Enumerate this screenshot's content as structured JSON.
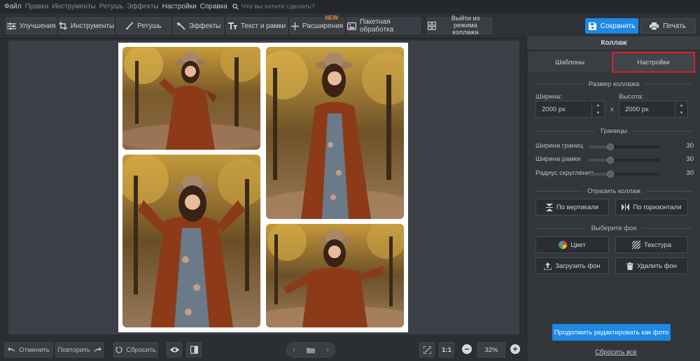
{
  "menu": {
    "items": [
      "Файл",
      "Правка",
      "Инструменты",
      "Ретушь",
      "Эффекты",
      "Настройки",
      "Справка"
    ],
    "search_placeholder": "Что вы хотите сделать?"
  },
  "toolbar": {
    "enhance": "Улучшения",
    "tools": "Инструменты",
    "retouch": "Ретушь",
    "effects": "Эффекты",
    "text_frames": "Текст и рамки",
    "extensions": "Расширения",
    "new_badge": "NEW",
    "batch": "Пакетная обработка",
    "exit_collage_line1": "Выйти из режима",
    "exit_collage_line2": "коллажа",
    "save": "Сохранить",
    "print": "Печать"
  },
  "bottom": {
    "undo": "Отменить",
    "redo": "Повторить",
    "reset": "Сбросить",
    "ratio": "1:1",
    "zoom": "32%"
  },
  "panel": {
    "title": "Коллаж",
    "tabs": [
      "Шаблоны",
      "Настройки"
    ],
    "active_tab": "Настройки",
    "size_section": "Размер коллажа",
    "width_label": "Ширина:",
    "height_label": "Высота:",
    "width_value": "2000 px",
    "height_value": "2000 px",
    "times": "x",
    "borders_section": "Границы",
    "sliders": [
      {
        "label": "Ширина границ",
        "value": "30",
        "fraction": 0.3
      },
      {
        "label": "Ширина рамки",
        "value": "30",
        "fraction": 0.3
      },
      {
        "label": "Радиус скругления",
        "value": "30",
        "fraction": 0.3
      }
    ],
    "flip_section": "Отразить коллаж",
    "flip_vertical": "По вертикали",
    "flip_horizontal": "По горизонтали",
    "bg_section": "Выберите фон",
    "color": "Цвет",
    "texture": "Текстура",
    "upload_bg": "Загрузить фон",
    "delete_bg": "Удалить фон",
    "continue": "Продолжить редактировать как фото",
    "reset_all": "Сбросить все"
  },
  "colors": {
    "accent": "#1e88e5",
    "highlight": "#e02020",
    "new_badge": "#f08b2a"
  }
}
